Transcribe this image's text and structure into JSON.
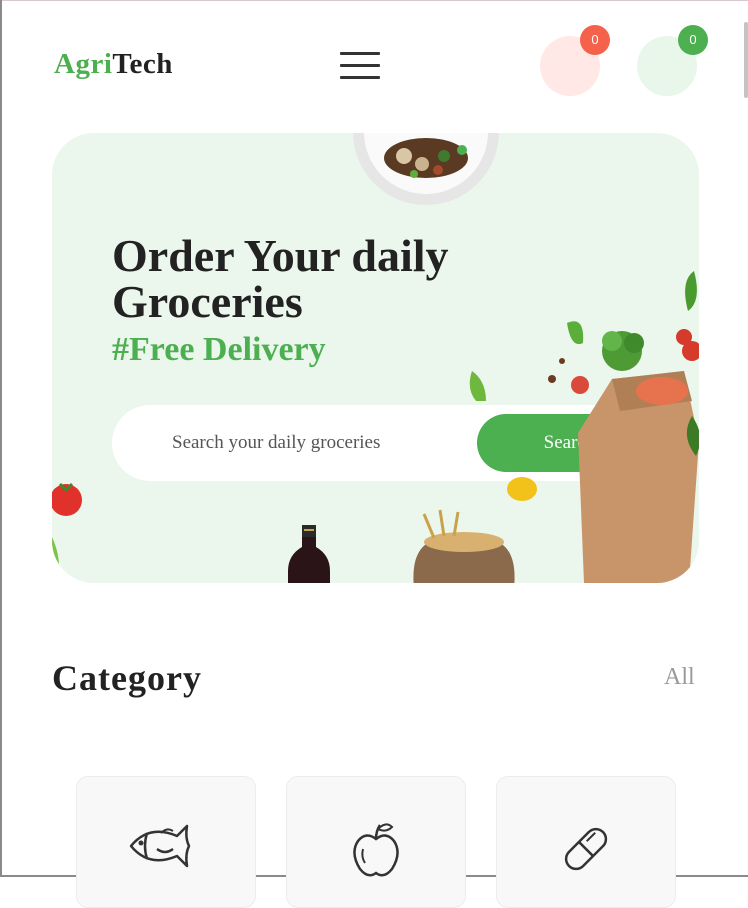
{
  "header": {
    "logo_part1": "Agri",
    "logo_part2": "Tech",
    "cart_count": "0",
    "wishlist_count": "0"
  },
  "hero": {
    "title_line1": "Order Your daily",
    "title_line2": "Groceries",
    "subtitle": "#Free Delivery",
    "search_placeholder": "Search your daily groceries",
    "search_button": "Search"
  },
  "category": {
    "title": "Category",
    "all_link": "All",
    "items": [
      {
        "icon": "fish-icon"
      },
      {
        "icon": "apple-icon"
      },
      {
        "icon": "pill-icon"
      }
    ]
  },
  "colors": {
    "accent": "#4caf50",
    "hero_bg": "#ebf6ec",
    "badge_red": "#f4624c"
  }
}
